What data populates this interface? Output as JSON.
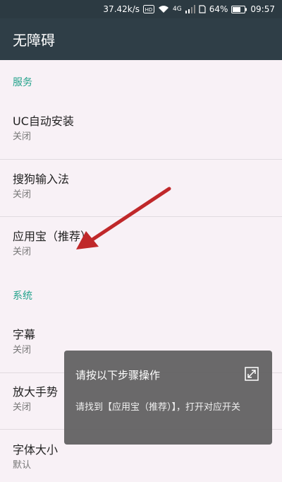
{
  "status_bar": {
    "speed": "37.42k/s",
    "network": "4G",
    "battery": "64%",
    "time": "09:57",
    "icons": [
      "hd-icon",
      "wifi-icon",
      "signal-icon",
      "sim-icon",
      "battery-icon"
    ]
  },
  "app_bar": {
    "title": "无障碍"
  },
  "sections": {
    "services": "服务",
    "system": "系统"
  },
  "items": [
    {
      "title": "UC自动安装",
      "sub": "关闭"
    },
    {
      "title": "搜狗输入法",
      "sub": "关闭"
    },
    {
      "title": "应用宝（推荐）",
      "sub": "关闭"
    },
    {
      "title": "字幕",
      "sub": "关闭"
    },
    {
      "title": "放大手势",
      "sub": "关闭"
    },
    {
      "title": "字体大小",
      "sub": "默认"
    }
  ],
  "toast": {
    "title": "请按以下步骤操作",
    "body": "请找到【应用宝（推荐）】，打开对应开关",
    "icon": "collapse-icon"
  },
  "colors": {
    "status_bar": "#2c3a42",
    "app_bar": "#2f3e47",
    "accent": "#25a38c",
    "arrow": "#c0282a"
  }
}
